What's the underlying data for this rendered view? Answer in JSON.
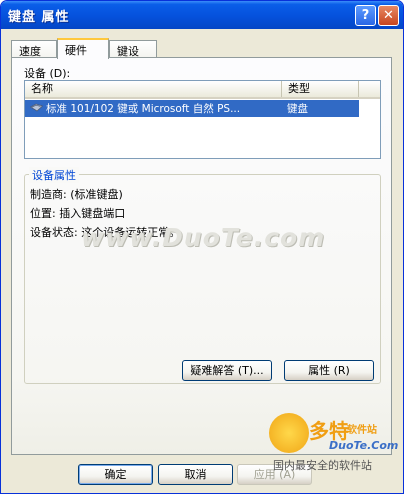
{
  "window": {
    "title": "键盘 属性",
    "help_glyph": "?",
    "close_glyph": "✕"
  },
  "tabs": [
    {
      "label": "速度",
      "active": false
    },
    {
      "label": "硬件",
      "active": true
    },
    {
      "label": "键设置",
      "active": false
    }
  ],
  "devices": {
    "label": "设备 (D):",
    "columns": [
      "名称",
      "类型"
    ],
    "rows": [
      {
        "name": "标准 101/102 键或 Microsoft 自然 PS...",
        "type": "键盘",
        "icon": "keyboard-icon",
        "selected": true
      }
    ]
  },
  "properties": {
    "title": "设备属性",
    "manufacturer": "制造商: (标准键盘)",
    "location": "位置: 插入键盘端口",
    "status": "设备状态: 这个设备运转正常。"
  },
  "buttons": {
    "troubleshoot": "疑难解答 (T)...",
    "properties": "属性 (R)",
    "ok": "确定",
    "cancel": "取消",
    "apply": "应用 (A)"
  },
  "watermark": {
    "text": "www.DuoTe.com"
  },
  "logo": {
    "brand": "多特",
    "brand_sub": "软件站",
    "url": "DuoTe.Com",
    "slogan": "国内最安全的软件站"
  },
  "colors": {
    "titlebar": "#0551dc",
    "selection": "#316ac5",
    "group_title": "#0046d5",
    "face": "#ece9d8"
  }
}
